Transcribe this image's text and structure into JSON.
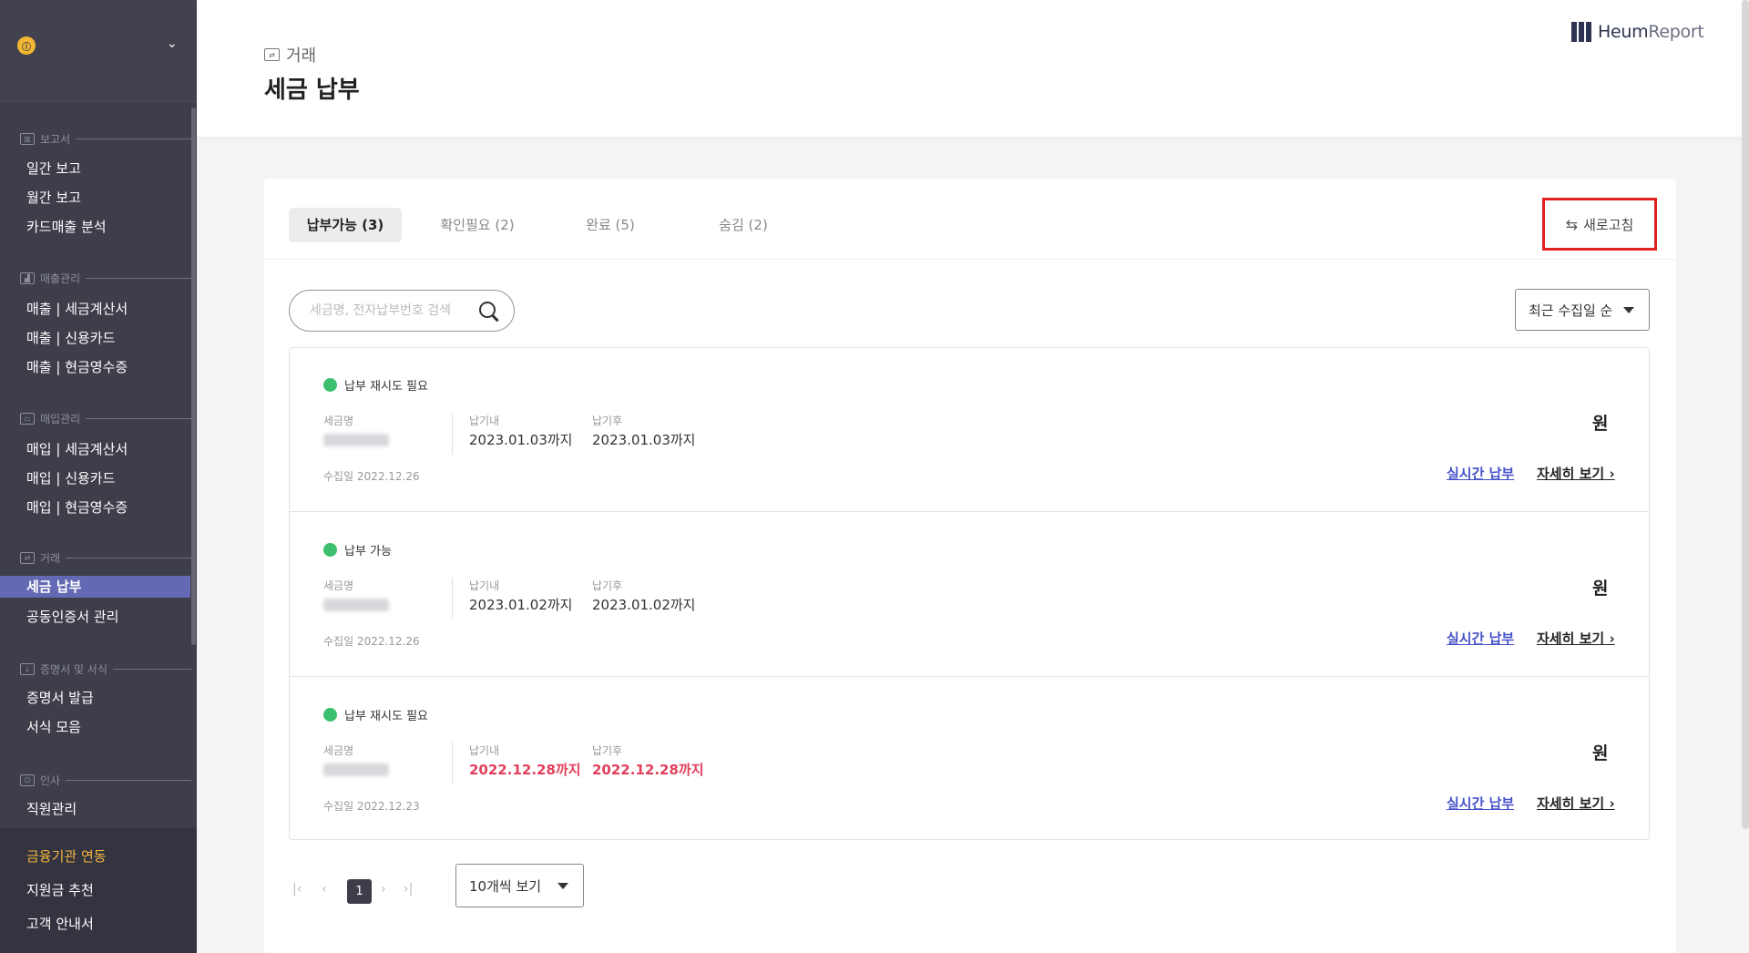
{
  "sidebar": {
    "logo_text": "ⓘ",
    "sections": [
      {
        "title": "보고서",
        "items": [
          "일간 보고",
          "월간 보고",
          "카드매출 분석"
        ]
      },
      {
        "title": "매출관리",
        "items": [
          "매출 | 세금계산서",
          "매출 | 신용카드",
          "매출 | 현금영수증"
        ]
      },
      {
        "title": "매입관리",
        "items": [
          "매입 | 세금계산서",
          "매입 | 신용카드",
          "매입 | 현금영수증"
        ]
      },
      {
        "title": "거래",
        "items": [
          "세금 납부",
          "공동인증서 관리"
        ]
      },
      {
        "title": "증명서 및 서식",
        "items": [
          "증명서 발급",
          "서식 모음"
        ]
      },
      {
        "title": "인사",
        "items": [
          "직원관리"
        ]
      }
    ],
    "active_item": "세금 납부",
    "bottom": {
      "finance": "금융기관 연동",
      "grant": "지원금 추천",
      "guide": "고객 안내서"
    }
  },
  "header": {
    "breadcrumb": "거래",
    "title": "세금 납부",
    "brand_bold": "Heum",
    "brand_light": "Report"
  },
  "tabs": [
    {
      "label": "납부가능 (3)",
      "active": true
    },
    {
      "label": "확인필요 (2)",
      "active": false
    },
    {
      "label": "완료 (5)",
      "active": false
    },
    {
      "label": "숨김 (2)",
      "active": false
    }
  ],
  "refresh_label": "새로고침",
  "search": {
    "placeholder": "세금명, 전자납부번호 검색",
    "value": ""
  },
  "sort": {
    "selected": "최근 수집일 순"
  },
  "labels": {
    "tax_name": "세금명",
    "due_within": "납기내",
    "due_after": "납기후",
    "currency": "원",
    "pay_now": "실시간 납부",
    "details": "자세히 보기"
  },
  "rows": [
    {
      "status": "납부 재시도 필요",
      "due_within": "2023.01.03까지",
      "due_after": "2023.01.03까지",
      "overdue": false,
      "collected": "수집일 2022.12.26"
    },
    {
      "status": "납부 가능",
      "due_within": "2023.01.02까지",
      "due_after": "2023.01.02까지",
      "overdue": false,
      "collected": "수집일 2022.12.26"
    },
    {
      "status": "납부 재시도 필요",
      "due_within": "2022.12.28까지",
      "due_after": "2022.12.28까지",
      "overdue": true,
      "collected": "수집일 2022.12.23"
    }
  ],
  "colors": {
    "accent": "#636ab3",
    "status_green": "#3dc06d",
    "overdue_red": "#e0405a",
    "link_blue": "#4652c8",
    "highlight_red": "#e02020"
  },
  "pagination": {
    "current_page": "1",
    "first": "|‹",
    "prev": "‹",
    "next": "›",
    "last": "›|"
  },
  "per_page": {
    "selected": "10개씩 보기"
  }
}
